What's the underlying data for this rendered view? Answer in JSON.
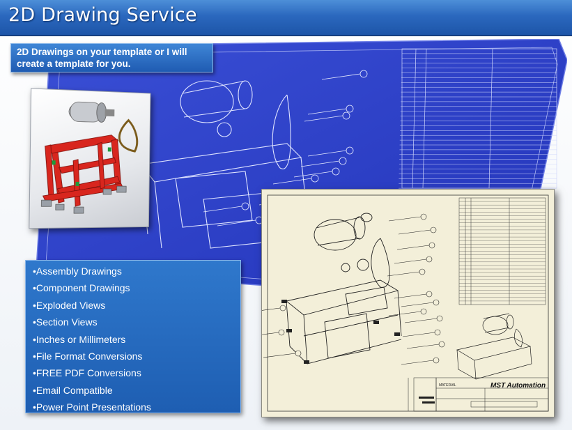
{
  "header": {
    "title": "2D Drawing Service"
  },
  "tagline": {
    "text": "2D Drawings on your template or I will create a template for you."
  },
  "services": {
    "items": [
      "•Assembly Drawings",
      "•Component Drawings",
      "•Exploded Views",
      "•Section Views",
      "•Inches or Millimeters",
      "•File Format Conversions",
      "•FREE PDF Conversions",
      "•Email Compatible",
      "•Power Point Presentations"
    ]
  },
  "drawing_sheet": {
    "company": "MST Automation",
    "material_label": "MATERIAL"
  },
  "colors": {
    "title_bar": "#2b68be",
    "blueprint": "#2d3ec9",
    "panel": "#2666bd",
    "sheet": "#f3efd9",
    "model_frame": "#d8261e"
  }
}
